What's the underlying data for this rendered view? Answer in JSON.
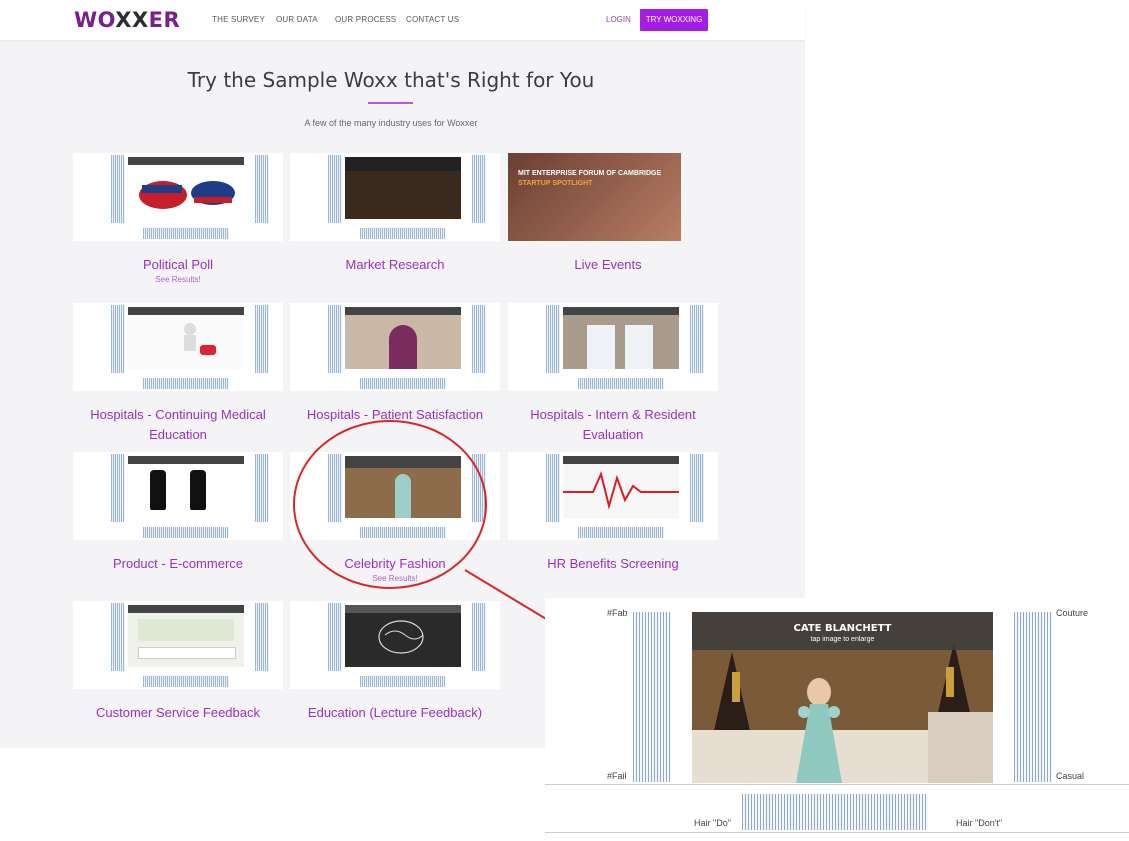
{
  "nav": {
    "logo": {
      "left": "WO",
      "mid": "XX",
      "right": "ER"
    },
    "links": [
      "THE SURVEY",
      "OUR DATA",
      "OUR PROCESS",
      "CONTACT US"
    ],
    "login": "LOGIN",
    "cta": "TRY WOXXING"
  },
  "header": {
    "title": "Try the Sample Woxx that's Right for You",
    "subtitle": "A few of the many industry uses for Woxxer"
  },
  "samples": [
    {
      "title": "Political Poll",
      "link": "See Results!"
    },
    {
      "title": "Market Research"
    },
    {
      "title": "Live Events",
      "banner1": "MIT ENTERPRISE FORUM OF CAMBRIDGE",
      "banner2": "STARTUP SPOTLIGHT"
    },
    {
      "title": "Hospitals - Continuing Medical Education"
    },
    {
      "title": "Hospitals - Patient Satisfaction"
    },
    {
      "title": "Hospitals - Intern & Resident Evaluation"
    },
    {
      "title": "Product - E-commerce"
    },
    {
      "title": "Celebrity Fashion",
      "link": "See Results!"
    },
    {
      "title": "HR Benefits Screening"
    },
    {
      "title": "Customer Service Feedback"
    },
    {
      "title": "Education (Lecture Feedback)"
    }
  ],
  "zoom": {
    "title": "CATE BLANCHETT",
    "hint": "tap image to enlarge",
    "left_top": "#Fab",
    "left_bottom": "#Fail",
    "right_top": "Couture",
    "right_bottom": "Casual",
    "bottom_left": "Hair \"Do\"",
    "bottom_right": "Hair \"Don't\""
  }
}
